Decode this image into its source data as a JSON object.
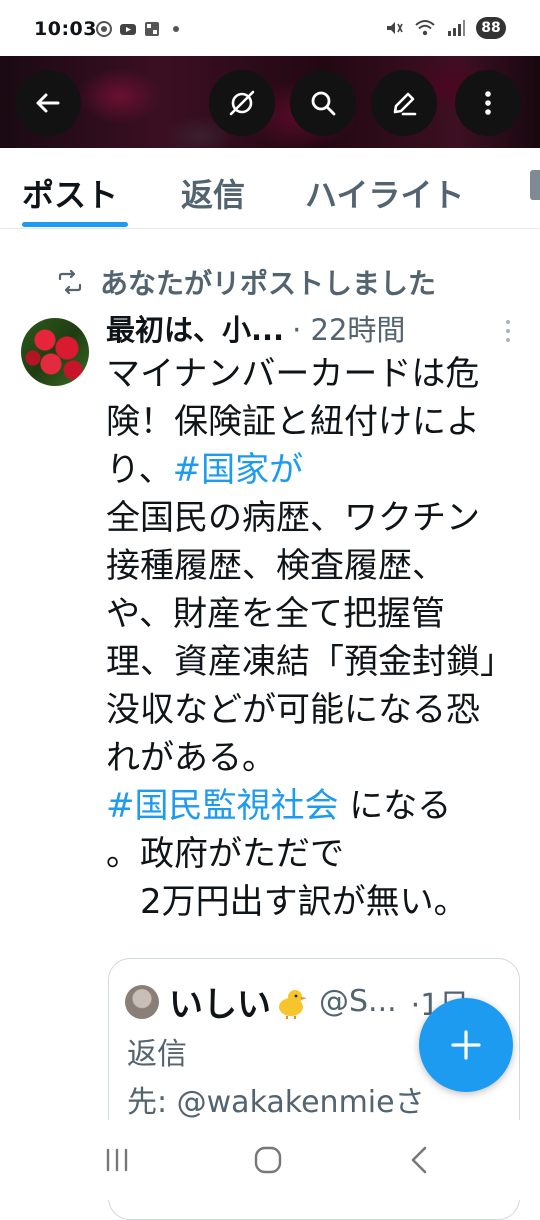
{
  "status_bar": {
    "time": "10:03",
    "battery": "88",
    "icons": [
      "chrome-icon",
      "youtube-icon",
      "qr-app-icon",
      "dot-icon",
      "mute-icon",
      "wifi-icon",
      "signal-icon"
    ]
  },
  "top_nav": {
    "buttons": [
      "back-arrow-icon",
      "grok-icon",
      "search-icon",
      "edit-icon",
      "more-vertical-icon"
    ]
  },
  "tabs": {
    "items": [
      "ポスト",
      "返信",
      "ハイライト"
    ],
    "active": "ポスト",
    "accent_color": "#1d9bf0"
  },
  "post": {
    "repost_label": "あなたがリポストしました",
    "author": "最初は、小...",
    "time": "· 22時間",
    "lines": [
      {
        "text": "マイナンバーカードは危",
        "hashtag": ""
      },
      {
        "text": "険！保険証と紐付けによ",
        "hashtag": ""
      },
      {
        "text": "り、",
        "hashtag": "#国家が"
      },
      {
        "text": "全国民の病歴、ワクチン",
        "hashtag": ""
      },
      {
        "text": "接種履歴、検査履歴、",
        "hashtag": ""
      },
      {
        "text": "や、財産を全て把握管",
        "hashtag": ""
      },
      {
        "text": "理、資産凍結「預金封鎖」",
        "hashtag": ""
      },
      {
        "text": "没収などが可能になる恐",
        "hashtag": ""
      },
      {
        "text": "れがある。",
        "hashtag": ""
      }
    ],
    "hashtag_line": {
      "hashtag": "#国民監視社会",
      "text": " になる"
    },
    "line_after_1": "。政府がただで",
    "line_after_2": "　2万円出す訳が無い。"
  },
  "quote": {
    "name": "いしい",
    "handle": "@S...",
    "time": "·1日",
    "line1": "返信",
    "line2": "先: @wakakenmieさ"
  },
  "fab": {
    "icon": "plus-icon"
  },
  "system_nav": [
    "recents-icon",
    "home-icon",
    "back-icon"
  ]
}
